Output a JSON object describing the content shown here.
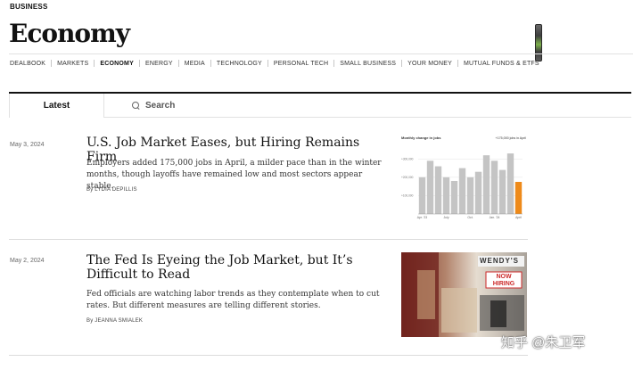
{
  "header": {
    "kicker": "BUSINESS",
    "title": "Economy"
  },
  "subnav": {
    "items": [
      {
        "label": "DEALBOOK",
        "active": false
      },
      {
        "label": "MARKETS",
        "active": false
      },
      {
        "label": "ECONOMY",
        "active": true
      },
      {
        "label": "ENERGY",
        "active": false
      },
      {
        "label": "MEDIA",
        "active": false
      },
      {
        "label": "TECHNOLOGY",
        "active": false
      },
      {
        "label": "PERSONAL TECH",
        "active": false
      },
      {
        "label": "SMALL BUSINESS",
        "active": false
      },
      {
        "label": "YOUR MONEY",
        "active": false
      },
      {
        "label": "MUTUAL FUNDS & ETFS",
        "active": false
      }
    ]
  },
  "tabs": {
    "latest": "Latest",
    "search": "Search"
  },
  "stories": [
    {
      "date": "May 3, 2024",
      "headline": "U.S. Job Market Eases, but Hiring Remains Firm",
      "summary": "Employers added 175,000 jobs in April, a milder pace than in the winter months, though layoffs have remained low and most sectors appear stable.",
      "byline": "By LYDIA DEPILLIS"
    },
    {
      "date": "May 2, 2024",
      "headline": "The Fed Is Eyeing the Job Market, but It’s Difficult to Read",
      "summary": "Fed officials are watching labor trends as they contemplate when to cut rates. But different measures are telling different stories.",
      "byline": "By JEANNA SMIALEK"
    }
  ],
  "chart_data": {
    "type": "bar",
    "title": "Monthly change in jobs",
    "annotation": "+175,000 jobs in April",
    "categories": [
      "Apr. '23",
      "",
      "",
      "July",
      "",
      "",
      "Oct.",
      "",
      "",
      "Jan. '24",
      "",
      "",
      "April"
    ],
    "values": [
      200000,
      290000,
      260000,
      200000,
      180000,
      250000,
      200000,
      230000,
      320000,
      290000,
      240000,
      330000,
      175000
    ],
    "ylim": [
      0,
      350000
    ],
    "tick_labels": [
      "+300,000",
      "+200,000",
      "+100,000"
    ],
    "grid": true,
    "highlight_color": "#ee8a1a",
    "bar_color": "#c4c4c4"
  },
  "photo": {
    "sign_text": "WENDY'S",
    "sign_sub": "NOW HIRING",
    "alt": "Wendy's now hiring sign"
  },
  "watermark": "知乎 @朱卫军"
}
